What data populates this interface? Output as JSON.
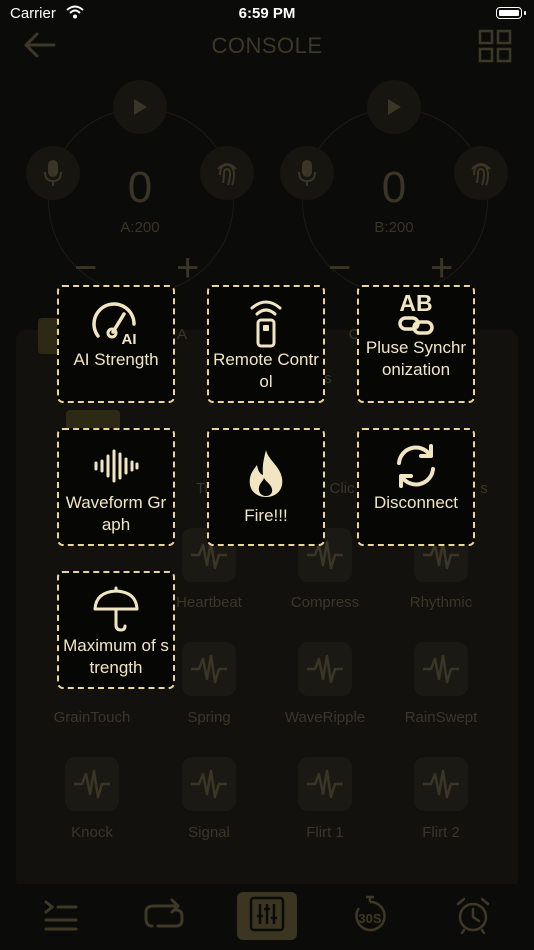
{
  "status_bar": {
    "carrier": "Carrier",
    "time": "6:59 PM"
  },
  "header": {
    "title": "CONSOLE"
  },
  "channels": [
    {
      "value": "0",
      "limit": "A:200"
    },
    {
      "value": "0",
      "limit": "B:200"
    }
  ],
  "background_labels": [
    "A",
    "C",
    "s",
    "Ti",
    "Clic",
    "s"
  ],
  "waveforms": [
    {
      "label": "Heartbeat"
    },
    {
      "label": "Compress"
    },
    {
      "label": "Rhythmic"
    },
    {
      "label": "GrainTouch"
    },
    {
      "label": "Spring"
    },
    {
      "label": "WaveRipple"
    },
    {
      "label": "RainSwept"
    },
    {
      "label": "Knock"
    },
    {
      "label": "Signal"
    },
    {
      "label": "Flirt 1"
    },
    {
      "label": "Flirt 2"
    }
  ],
  "menu": [
    {
      "label": "AI Strength",
      "icon": "gauge-ai-icon"
    },
    {
      "label": "Remote Control",
      "icon": "remote-icon"
    },
    {
      "label": "Pluse Synchronization",
      "icon": "ab-link-icon"
    },
    {
      "label": "Waveform Graph",
      "icon": "waveform-icon"
    },
    {
      "label": "Fire!!!",
      "icon": "flame-icon"
    },
    {
      "label": "Disconnect",
      "icon": "refresh-icon"
    },
    {
      "label": "Maximum of strength",
      "icon": "umbrella-icon"
    }
  ],
  "tabbar": [
    {
      "icon": "list-icon"
    },
    {
      "icon": "loop-icon"
    },
    {
      "icon": "mixer-icon",
      "active": true
    },
    {
      "icon": "timer-30s-icon",
      "badge": "30S"
    },
    {
      "icon": "alarm-clock-icon"
    }
  ],
  "colors": {
    "accent": "#f0e5bc",
    "dashed_border": "#e9d598",
    "background": "#0b0b09"
  }
}
